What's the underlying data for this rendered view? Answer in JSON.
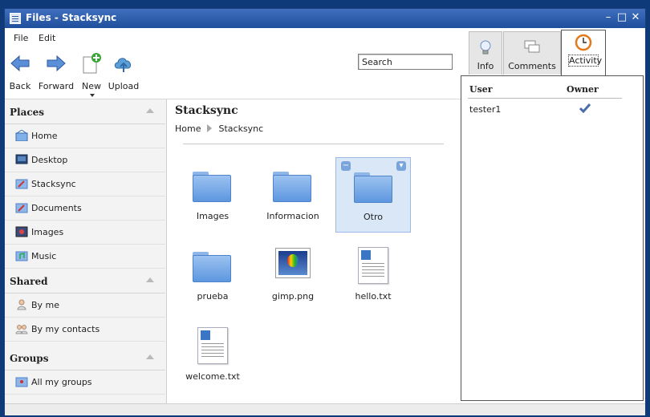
{
  "window": {
    "title": "Files - Stacksync"
  },
  "menu": {
    "file": "File",
    "edit": "Edit"
  },
  "toolbar": {
    "back": "Back",
    "forward": "Forward",
    "new": "New",
    "upload": "Upload"
  },
  "search": {
    "value": "Search"
  },
  "sidebar": {
    "places": {
      "title": "Places",
      "items": [
        "Home",
        "Desktop",
        "Stacksync",
        "Documents",
        "Images",
        "Music"
      ]
    },
    "shared": {
      "title": "Shared",
      "items": [
        "By me",
        "By my contacts"
      ]
    },
    "groups": {
      "title": "Groups",
      "items": [
        "All my groups"
      ]
    }
  },
  "main": {
    "title": "Stacksync",
    "breadcrumb": [
      "Home",
      "Stacksync"
    ],
    "files": [
      "Images",
      "Informacion",
      "Otro",
      "prueba",
      "gimp.png",
      "hello.txt",
      "welcome.txt"
    ]
  },
  "details": {
    "tabs": [
      "Info",
      "Comments",
      "Activity"
    ],
    "active_tab": "Activity",
    "columns": [
      "User",
      "Owner"
    ],
    "rows": [
      {
        "user": "tester1",
        "owner": "check-icon"
      }
    ]
  },
  "colors": {
    "titlebar": "#2d5aa0",
    "accent": "#5d97e0",
    "selection": "#d9e7f7"
  }
}
